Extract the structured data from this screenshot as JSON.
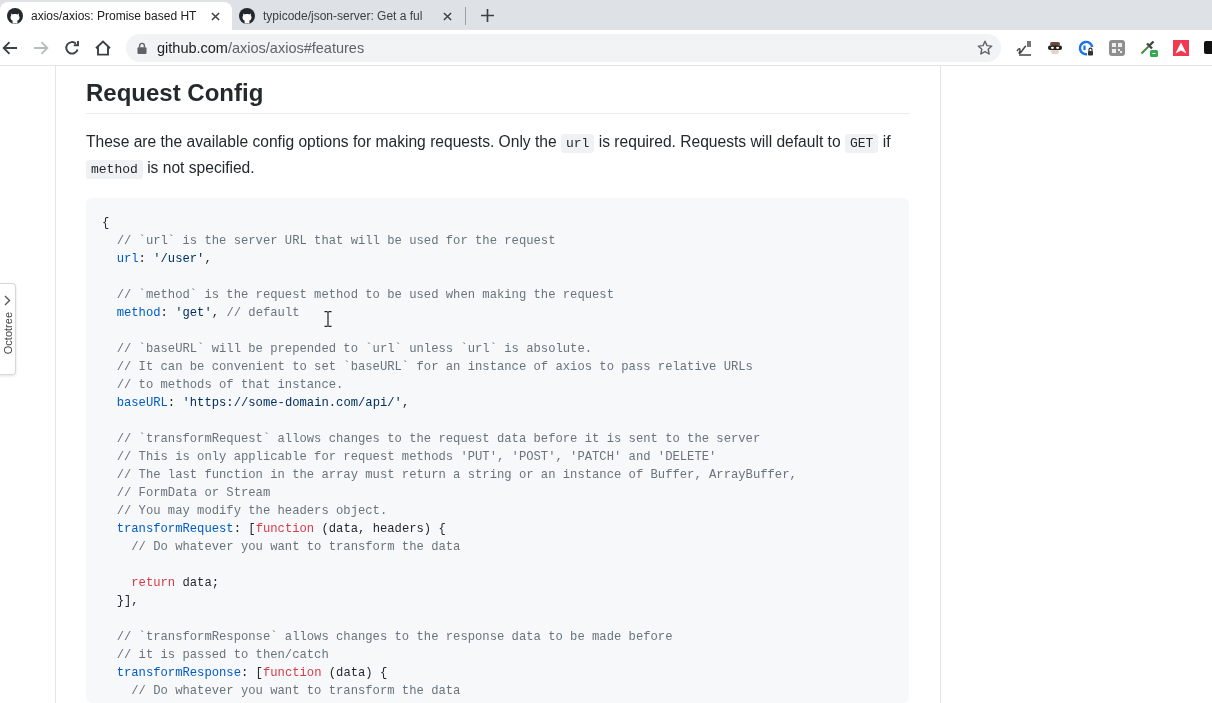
{
  "tabs": [
    {
      "title": "axios/axios: Promise based HT",
      "selected": true
    },
    {
      "title": "typicode/json-server: Get a ful",
      "selected": false
    }
  ],
  "toolbar": {
    "nav_buttons": [
      {
        "kind": "back",
        "disabled": false
      },
      {
        "kind": "forward",
        "disabled": true
      },
      {
        "kind": "reload",
        "disabled": false
      },
      {
        "kind": "home",
        "disabled": false
      }
    ],
    "address": {
      "host": "github.com",
      "path": "/axios/axios#features"
    }
  },
  "side_tab": {
    "label": "Octotree"
  },
  "article": {
    "heading": "Request Config",
    "paragraph": [
      {
        "kind": "text",
        "text": "These are the available config options for making requests. Only the "
      },
      {
        "kind": "code",
        "text": "url"
      },
      {
        "kind": "text",
        "text": " is required. Requests will default to "
      },
      {
        "kind": "code",
        "text": "GET"
      },
      {
        "kind": "text",
        "text": " if "
      },
      {
        "kind": "code",
        "text": "method"
      },
      {
        "kind": "text",
        "text": " is not specified."
      }
    ],
    "code_block": {
      "groups": [
        {
          "lines": [
            {
              "tokens": [
                {
                  "kind": "punct",
                  "text": "{"
                }
              ]
            },
            {
              "tokens": [
                {
                  "kind": "comment",
                  "text": "  // `url` is the server URL that will be used for the request"
                }
              ]
            },
            {
              "tokens": [
                {
                  "kind": "property",
                  "text": "  url"
                },
                {
                  "kind": "punct",
                  "text": ": "
                },
                {
                  "kind": "string",
                  "text": "'/user'"
                },
                {
                  "kind": "punct",
                  "text": ","
                }
              ]
            }
          ]
        },
        {
          "lines": [
            {
              "tokens": [
                {
                  "kind": "comment",
                  "text": "  // `method` is the request method to be used when making the request"
                }
              ]
            },
            {
              "tokens": [
                {
                  "kind": "property",
                  "text": "  method"
                },
                {
                  "kind": "punct",
                  "text": ": "
                },
                {
                  "kind": "string",
                  "text": "'get'"
                },
                {
                  "kind": "punct",
                  "text": ", "
                },
                {
                  "kind": "comment",
                  "text": "// default"
                }
              ]
            }
          ]
        },
        {
          "lines": [
            {
              "tokens": [
                {
                  "kind": "comment",
                  "text": "  // `baseURL` will be prepended to `url` unless `url` is absolute."
                }
              ]
            },
            {
              "tokens": [
                {
                  "kind": "comment",
                  "text": "  // It can be convenient to set `baseURL` for an instance of axios to pass relative URLs"
                }
              ]
            },
            {
              "tokens": [
                {
                  "kind": "comment",
                  "text": "  // to methods of that instance."
                }
              ]
            },
            {
              "tokens": [
                {
                  "kind": "property",
                  "text": "  baseURL"
                },
                {
                  "kind": "punct",
                  "text": ": "
                },
                {
                  "kind": "string",
                  "text": "'https://some-domain.com/api/'"
                },
                {
                  "kind": "punct",
                  "text": ","
                }
              ]
            }
          ]
        },
        {
          "lines": [
            {
              "tokens": [
                {
                  "kind": "comment",
                  "text": "  // `transformRequest` allows changes to the request data before it is sent to the server"
                }
              ]
            },
            {
              "tokens": [
                {
                  "kind": "comment",
                  "text": "  // This is only applicable for request methods 'PUT', 'POST', 'PATCH' and 'DELETE'"
                }
              ]
            },
            {
              "tokens": [
                {
                  "kind": "comment",
                  "text": "  // The last function in the array must return a string or an instance of Buffer, ArrayBuffer,"
                }
              ]
            },
            {
              "tokens": [
                {
                  "kind": "comment",
                  "text": "  // FormData or Stream"
                }
              ]
            },
            {
              "tokens": [
                {
                  "kind": "comment",
                  "text": "  // You may modify the headers object."
                }
              ]
            },
            {
              "tokens": [
                {
                  "kind": "property",
                  "text": "  transformRequest"
                },
                {
                  "kind": "punct",
                  "text": ": ["
                },
                {
                  "kind": "keyword",
                  "text": "function"
                },
                {
                  "kind": "punct",
                  "text": " (data, headers) {"
                }
              ]
            },
            {
              "tokens": [
                {
                  "kind": "comment",
                  "text": "    // Do whatever you want to transform the data"
                }
              ]
            }
          ]
        },
        {
          "lines": [
            {
              "tokens": [
                {
                  "kind": "keyword",
                  "text": "    return"
                },
                {
                  "kind": "punct",
                  "text": " data;"
                }
              ]
            },
            {
              "tokens": [
                {
                  "kind": "punct",
                  "text": "  }],"
                }
              ]
            }
          ]
        },
        {
          "lines": [
            {
              "tokens": [
                {
                  "kind": "comment",
                  "text": "  // `transformResponse` allows changes to the response data to be made before"
                }
              ]
            },
            {
              "tokens": [
                {
                  "kind": "comment",
                  "text": "  // it is passed to then/catch"
                }
              ]
            },
            {
              "tokens": [
                {
                  "kind": "property",
                  "text": "  transformResponse"
                },
                {
                  "kind": "punct",
                  "text": ": ["
                },
                {
                  "kind": "keyword",
                  "text": "function"
                },
                {
                  "kind": "punct",
                  "text": " (data) {"
                }
              ]
            },
            {
              "tokens": [
                {
                  "kind": "comment",
                  "text": "    // Do whatever you want to transform the data"
                }
              ]
            }
          ]
        }
      ]
    }
  }
}
